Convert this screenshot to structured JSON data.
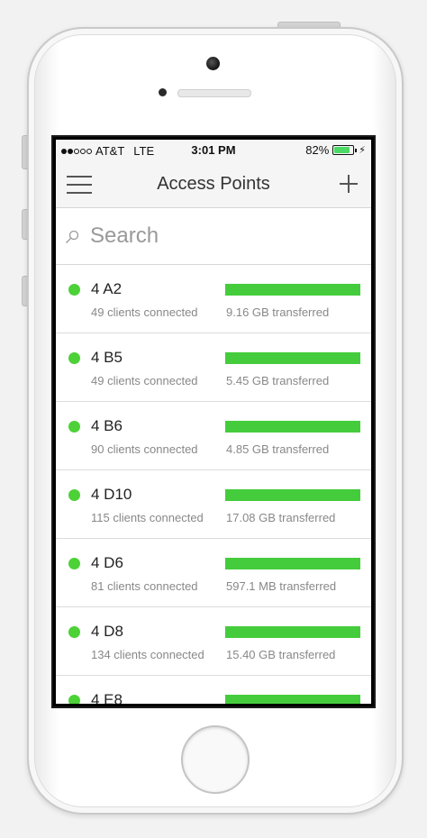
{
  "status_bar": {
    "signal_dots": [
      true,
      true,
      false,
      false,
      false
    ],
    "carrier": "AT&T",
    "network": "LTE",
    "time": "3:01 PM",
    "battery": "82%",
    "battery_level": 0.82
  },
  "navbar": {
    "title": "Access Points",
    "menu_icon": "hamburger-menu-icon",
    "add_icon": "plus-icon"
  },
  "search": {
    "placeholder": "Search",
    "icon": "search-icon"
  },
  "colors": {
    "status_online": "#4cd137",
    "usage_bar": "#45cc3c",
    "battery": "#4cd964"
  },
  "access_points": [
    {
      "name": "4 A2",
      "clients": "49 clients connected",
      "transfer": "9.16 GB transferred",
      "usage": 1.0
    },
    {
      "name": "4 B5",
      "clients": "49 clients connected",
      "transfer": "5.45 GB transferred",
      "usage": 1.0
    },
    {
      "name": "4 B6",
      "clients": "90 clients connected",
      "transfer": "4.85 GB transferred",
      "usage": 1.0
    },
    {
      "name": "4 D10",
      "clients": "115 clients connected",
      "transfer": "17.08 GB transferred",
      "usage": 1.0
    },
    {
      "name": "4 D6",
      "clients": "81 clients connected",
      "transfer": "597.1 MB transferred",
      "usage": 1.0
    },
    {
      "name": "4 D8",
      "clients": "134 clients connected",
      "transfer": "15.40 GB transferred",
      "usage": 1.0
    },
    {
      "name": "4 E8",
      "clients": "",
      "transfer": "",
      "usage": 1.0
    }
  ]
}
